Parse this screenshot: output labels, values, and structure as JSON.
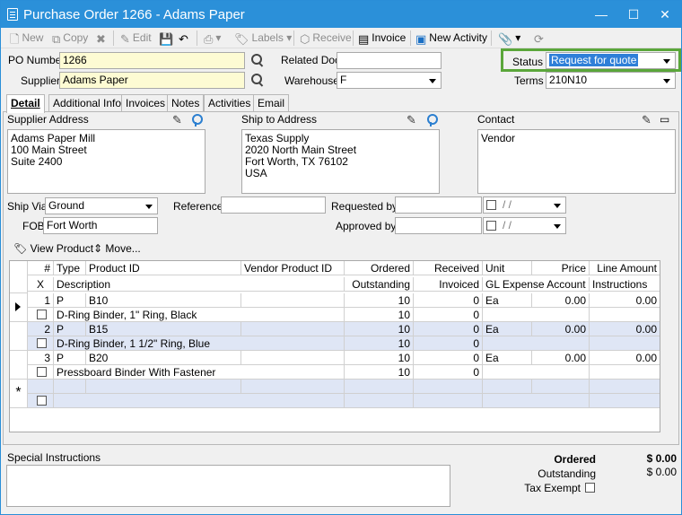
{
  "window": {
    "title": "Purchase Order 1266 - Adams Paper",
    "minimize": "—",
    "maximize": "☐",
    "close": "✕"
  },
  "toolbar": {
    "new": "New",
    "copy": "Copy",
    "edit": "Edit",
    "labels": "Labels",
    "receive": "Receive",
    "invoice": "Invoice",
    "new_activity": "New Activity"
  },
  "header": {
    "po_number_label": "PO Number",
    "po_number": "1266",
    "supplier_label": "Supplier",
    "supplier": "Adams Paper",
    "related_doc_label": "Related Doc",
    "related_doc": "",
    "warehouse_label": "Warehouse",
    "warehouse": "F",
    "status_label": "Status",
    "status": "Request for quote",
    "terms_label": "Terms",
    "terms": "210N10"
  },
  "tabs": [
    "Detail",
    "Additional Info",
    "Invoices",
    "Notes",
    "Activities",
    "Email"
  ],
  "detail": {
    "supplier_address_label": "Supplier Address",
    "supplier_address": "Adams Paper Mill\n100 Main Street\nSuite 2400",
    "ship_to_label": "Ship to Address",
    "ship_to": "Texas Supply\n2020 North Main Street\nFort Worth, TX 76102\nUSA",
    "contact_label": "Contact",
    "contact": "Vendor",
    "ship_via_label": "Ship Via",
    "ship_via": "Ground",
    "fob_label": "FOB",
    "fob": "Fort Worth",
    "reference_label": "Reference",
    "reference": "",
    "requested_by_label": "Requested by",
    "requested_by": "",
    "approved_by_label": "Approved by",
    "approved_by": "",
    "date_placeholder": "/ /",
    "view_product": "View Product",
    "move": "Move..."
  },
  "grid": {
    "headers_top": [
      "#",
      "Type",
      "Product ID",
      "Vendor Product ID",
      "Ordered",
      "Received",
      "Unit",
      "Price",
      "Line Amount"
    ],
    "headers_bottom": [
      "X",
      "Description",
      "Outstanding",
      "Invoiced",
      "GL Expense Account",
      "Instructions"
    ],
    "rows": [
      {
        "num": "1",
        "type": "P",
        "product_id": "B10",
        "vendor_product_id": "",
        "ordered": "10",
        "received": "0",
        "unit": "Ea",
        "price": "0.00",
        "line_amount": "0.00",
        "description": "D-Ring Binder, 1\" Ring, Black",
        "outstanding": "10",
        "invoiced": "0"
      },
      {
        "num": "2",
        "type": "P",
        "product_id": "B15",
        "vendor_product_id": "",
        "ordered": "10",
        "received": "0",
        "unit": "Ea",
        "price": "0.00",
        "line_amount": "0.00",
        "description": "D-Ring Binder, 1 1/2\" Ring, Blue",
        "outstanding": "10",
        "invoiced": "0"
      },
      {
        "num": "3",
        "type": "P",
        "product_id": "B20",
        "vendor_product_id": "",
        "ordered": "10",
        "received": "0",
        "unit": "Ea",
        "price": "0.00",
        "line_amount": "0.00",
        "description": "Pressboard Binder With Fastener",
        "outstanding": "10",
        "invoiced": "0"
      }
    ],
    "new_row_marker": "*"
  },
  "footer": {
    "special_instructions_label": "Special Instructions",
    "special_instructions": "",
    "ordered_label": "Ordered",
    "ordered": "$ 0.00",
    "outstanding_label": "Outstanding",
    "outstanding": "$ 0.00",
    "tax_exempt_label": "Tax Exempt"
  },
  "colors": {
    "titlebar": "#2b90d9",
    "highlight": "#5aa63a",
    "row_alt": "#dfe6f5",
    "field_yellow": "#fdfbd3"
  }
}
